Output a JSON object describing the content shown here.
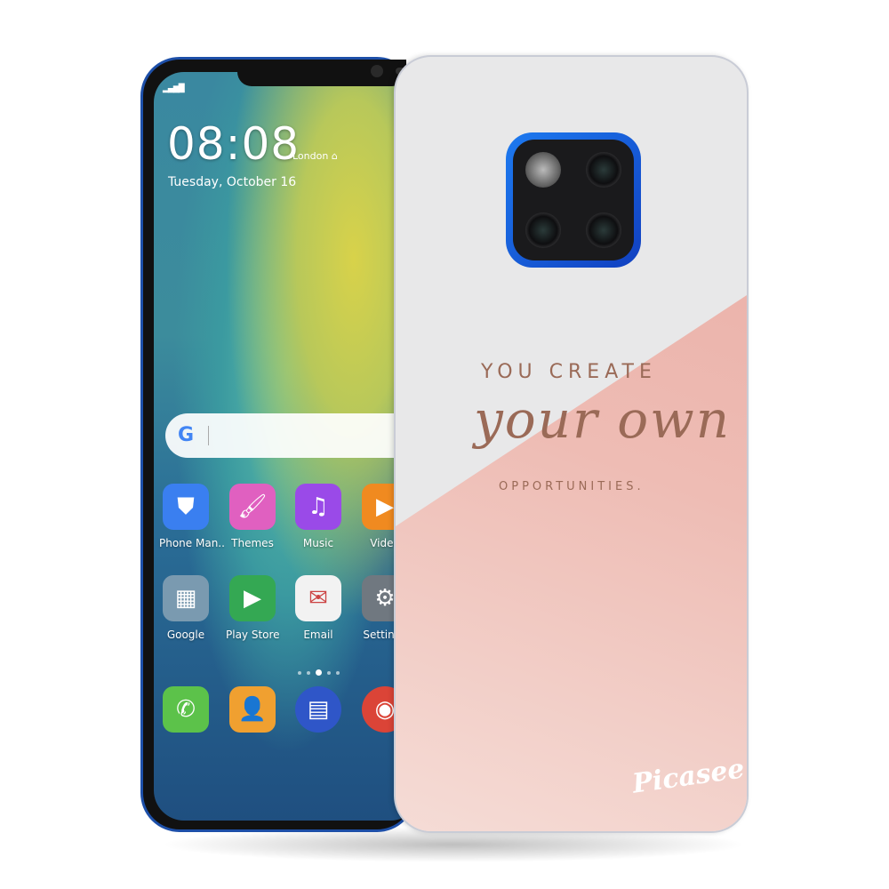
{
  "lockscreen": {
    "signal_icon": "signal-bars-icon",
    "time": "08:08",
    "city": "London",
    "home_icon": "home-icon",
    "date": "Tuesday, October 16"
  },
  "search_bar": {
    "icon": "google-g-icon",
    "glyph": "G"
  },
  "apps": [
    {
      "label": "Phone Man..",
      "icon": "shield-icon",
      "color": "#3a7ff0"
    },
    {
      "label": "Themes",
      "icon": "paintbrush-icon",
      "color": "#e060c0"
    },
    {
      "label": "Music",
      "icon": "music-note-icon",
      "color": "#9a4ae8"
    },
    {
      "label": "Video",
      "icon": "play-icon",
      "color": "#f08a20"
    },
    {
      "label": "Google",
      "icon": "folder-icon",
      "color": "#7a9ab0"
    },
    {
      "label": "Play Store",
      "icon": "play-store-icon",
      "color": "#34a853"
    },
    {
      "label": "Email",
      "icon": "envelope-icon",
      "color": "#f2f2f2"
    },
    {
      "label": "Settings",
      "icon": "gear-icon",
      "color": "#707880"
    }
  ],
  "dock": [
    {
      "icon": "phone-icon",
      "color": "#5cc24a"
    },
    {
      "icon": "contacts-icon",
      "color": "#f0a030"
    },
    {
      "icon": "messages-icon",
      "color": "#2f56c8"
    },
    {
      "icon": "chrome-icon",
      "color": "#db4437"
    }
  ],
  "page_indicator": {
    "count": 5,
    "active": 3
  },
  "case": {
    "line1": "YOU CREATE",
    "line2": "your own",
    "line3": "OPPORTUNITIES.",
    "brand": "Picasee",
    "camera_color": "#1d6ae8",
    "pink": "#eebcb4"
  }
}
